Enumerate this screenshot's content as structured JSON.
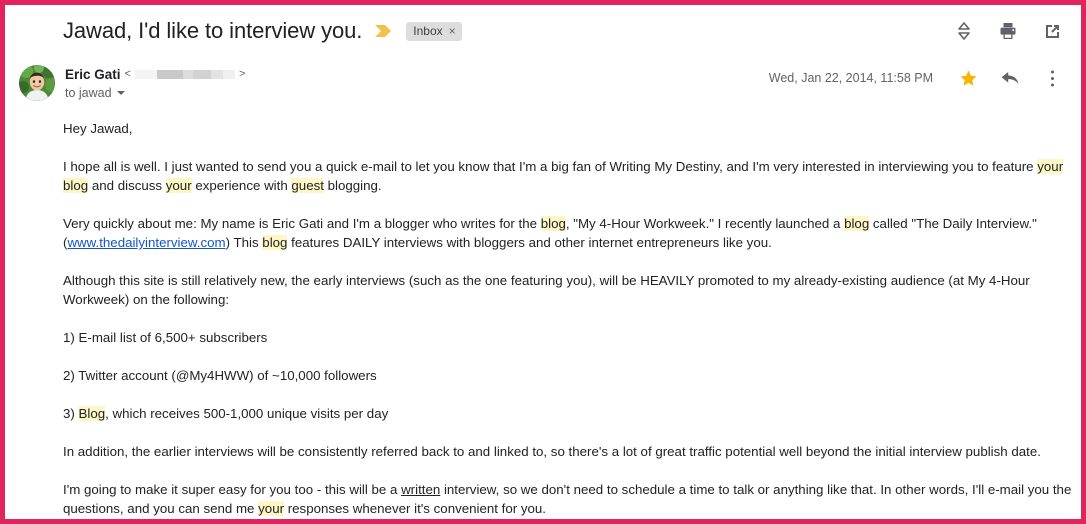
{
  "window": {
    "border_color": "#e0245e",
    "background": "#ffffff"
  },
  "subject": {
    "title": "Jawad, I'd like to interview you.",
    "important_marker_icon": "important-chevron-icon",
    "important_marker_color": "#f3c14a",
    "label": "Inbox",
    "label_close": "×",
    "actions": [
      {
        "name": "expand-collapse-icon",
        "title": "Expand all"
      },
      {
        "name": "print-icon",
        "title": "Print all"
      },
      {
        "name": "open-in-new-window-icon",
        "title": "Open in new window"
      }
    ]
  },
  "sender": {
    "avatar_alt": "Eric Gati profile photo",
    "name": "Eric Gati",
    "email_open_bracket": "<",
    "email_close_bracket": ">",
    "email_redacted": true,
    "recipient": "to jawad",
    "date": "Wed, Jan 22, 2014, 11:58 PM",
    "star_icon": "star-icon",
    "star_color": "#f4b400",
    "star_active": true,
    "reply_icon": "reply-icon",
    "more_icon": "more-vertical-icon"
  },
  "body": {
    "greeting": "Hey Jawad,",
    "p1": {
      "a": "I hope all is well.  I just wanted to send you a quick e-mail to let you know that I'm a big fan of Writing My Destiny, and I'm very interested in interviewing you to feature ",
      "hl1": "your blog",
      "b": " and discuss ",
      "hl2": "your",
      "c": " experience with ",
      "hl3": "guest",
      "d": " blogging."
    },
    "p2": {
      "a": "Very quickly about me: My name is Eric Gati and I'm a blogger who writes for the ",
      "hl1": "blog",
      "b": ", \"My 4-Hour Workweek.\" I recently launched a ",
      "hl2": "blog",
      "c": " called \"The Daily Interview.\" (",
      "link": "www.thedailyinterview.com",
      "d": ") This ",
      "hl3": "blog",
      "e": " features DAILY interviews with bloggers and other internet entrepreneurs like you."
    },
    "p3": "Although this site is still relatively new, the early interviews (such as the one featuring you), will be HEAVILY promoted to my already-existing audience (at My 4-Hour Workweek) on the following:",
    "list1": "1) E-mail list of 6,500+ subscribers",
    "list2": "2) Twitter account (@My4HWW) of ~10,000 followers",
    "list3": {
      "a": "3) ",
      "hl1": "Blog",
      "b": ", which receives 500-1,000 unique visits per day"
    },
    "p4": "In addition, the earlier interviews will be consistently referred back to and linked to, so there's a lot of great traffic potential well beyond the initial interview publish date.",
    "p5": {
      "a": "I'm going to make it super easy for you too - this will be a ",
      "u1": "written",
      "b": " interview, so we don't need to schedule a time to talk or anything like that.  In other words, I'll e-mail you the questions, and you can send me ",
      "hl1": "your",
      "c": " responses whenever it's convenient for you."
    }
  }
}
